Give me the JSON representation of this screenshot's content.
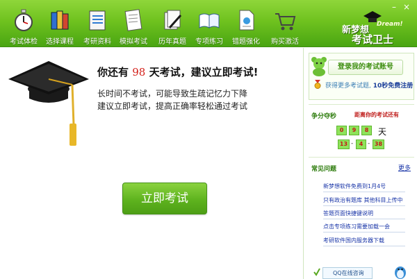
{
  "toolbar": {
    "items": [
      {
        "label": "考试体检",
        "icon": "stopwatch-icon"
      },
      {
        "label": "选择课程",
        "icon": "books-icon"
      },
      {
        "label": "考研资料",
        "icon": "notebook-icon"
      },
      {
        "label": "模拟考试",
        "icon": "exam-paper-icon"
      },
      {
        "label": "历年真题",
        "icon": "papers-pen-icon"
      },
      {
        "label": "专项练习",
        "icon": "open-book-icon"
      },
      {
        "label": "错题强化",
        "icon": "document-icon"
      },
      {
        "label": "购买激活",
        "icon": "shopping-cart-icon"
      }
    ]
  },
  "window": {
    "minimize_glyph": "–",
    "close_glyph": "×"
  },
  "logo": {
    "line1": "新梦想",
    "line2": "考试卫士",
    "tag": "Dream!"
  },
  "main": {
    "headline_prefix": "你还有",
    "days_number": "98",
    "headline_suffix": "天考试，建议立即考试!",
    "line1": "长时间不考试，可能导致生疏记忆力下降",
    "line2": "建议立即考试，提高正确率轻松通过考试",
    "start_button": "立即考试"
  },
  "sidebar": {
    "login_button": "登录我的考试账号",
    "promo_prefix": "获得更多考试题,",
    "promo_bold": "10秒免费注册",
    "countdown_title": "争分夺秒",
    "countdown_caption": "距离你的考试还有",
    "days_digits": [
      "0",
      "9",
      "8"
    ],
    "day_unit": "天",
    "time_digits": [
      "13",
      "4",
      "38"
    ],
    "faq_title": "常见问题",
    "more_link": "更多",
    "faq": [
      "新梦想软件免费到1月4号",
      "只有政治有题库 其他科目上传中",
      "答题页面快捷键说明",
      "点击专项练习需要加载一会",
      "考研软件国内服务器下载"
    ],
    "qq_button": "QQ在线咨询"
  },
  "colors": {
    "toolbar_green": "#6fc21f",
    "accent_red": "#d4201a",
    "link_blue": "#1a36a8",
    "digit_green": "#8ee35b"
  }
}
